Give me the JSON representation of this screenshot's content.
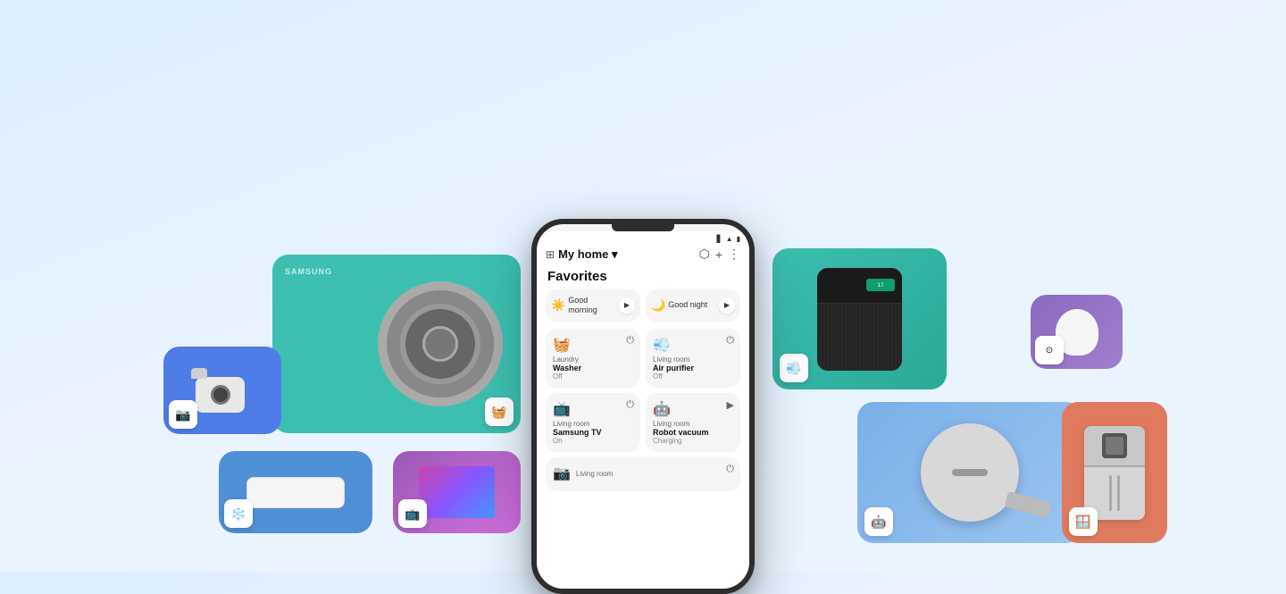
{
  "app": {
    "title": "My home",
    "title_arrow": "▾",
    "header_icons": [
      "⬡",
      "+",
      "⋮"
    ],
    "sections": {
      "favorites": "Favorites"
    },
    "scenes": [
      {
        "icon": "☀️",
        "label": "Good morning",
        "play": "▶"
      },
      {
        "icon": "🌙",
        "label": "Good night",
        "play": "▶"
      }
    ],
    "devices": [
      {
        "icon": "🧺",
        "room": "Laundry",
        "name": "Washer",
        "status": "Off",
        "action": "⏻"
      },
      {
        "icon": "💨",
        "room": "Living room",
        "name": "Air purifier",
        "status": "Off",
        "action": "⏻"
      },
      {
        "icon": "📺",
        "room": "Living room",
        "name": "Samsung TV",
        "status": "On",
        "action": "⏻"
      },
      {
        "icon": "🤖",
        "room": "Living room",
        "name": "Robot vacuum",
        "status": "Charging",
        "action": "▶"
      },
      {
        "icon": "📷",
        "room": "Living room",
        "name": "",
        "status": "",
        "action": "⏻"
      }
    ]
  },
  "cards": {
    "washer": {
      "label": "SAMSUNG",
      "badge": "🧺"
    },
    "camera": {
      "badge": "📷"
    },
    "ac": {
      "badge": "❄️"
    },
    "tv": {
      "badge": "📺"
    },
    "purifier": {
      "badge": "💨",
      "screen_text": "17"
    },
    "google": {
      "badge": "⊙"
    },
    "vacuum": {
      "badge": "🤖"
    },
    "fridge": {
      "badge": "🪟"
    }
  },
  "colors": {
    "bg_start": "#dceeff",
    "bg_end": "#eaf4ff",
    "teal": "#3cbfb0",
    "blue_card": "#4e7de8",
    "blue_light": "#4e90d6",
    "purple": "#9b59b6",
    "purple_light": "#8b6abf",
    "vacuum_blue": "#7ab0e8",
    "orange": "#e07a5f",
    "phone_border": "#2d2d2d"
  }
}
